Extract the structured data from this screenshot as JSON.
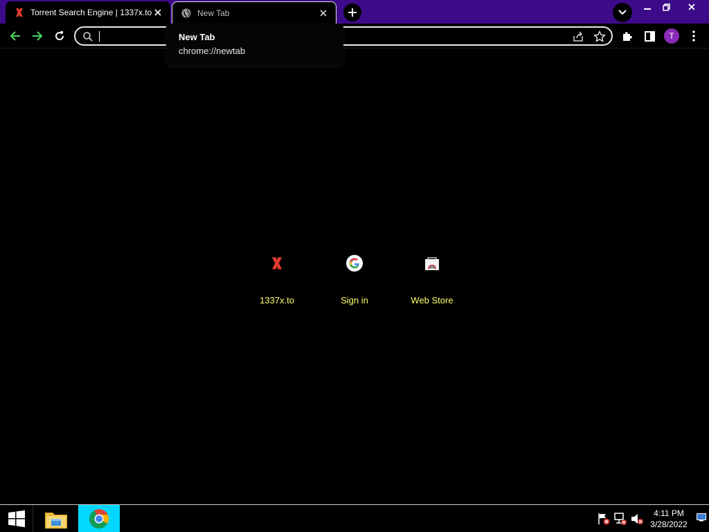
{
  "browser": {
    "tabs": [
      {
        "title": "Torrent Search Engine | 1337x.to",
        "favicon": "1337x-x-icon"
      },
      {
        "title": "New Tab",
        "favicon": "globe-icon"
      }
    ],
    "omnibox": {
      "value": "",
      "placeholder": ""
    },
    "profile_initial": "T",
    "accent_colors": {
      "tabstrip": "#3d0a8a",
      "shortcut_label": "#ffff66",
      "avatar": "#8a2ab8"
    }
  },
  "hovercard": {
    "title": "New Tab",
    "url": "chrome://newtab"
  },
  "shortcuts": [
    {
      "label": "1337x.to",
      "icon": "1337x-icon"
    },
    {
      "label": "Sign in",
      "icon": "google-icon"
    },
    {
      "label": "Web Store",
      "icon": "web-store-icon"
    }
  ],
  "taskbar": {
    "clock_time": "4:11 PM",
    "clock_date": "3/28/2022"
  }
}
